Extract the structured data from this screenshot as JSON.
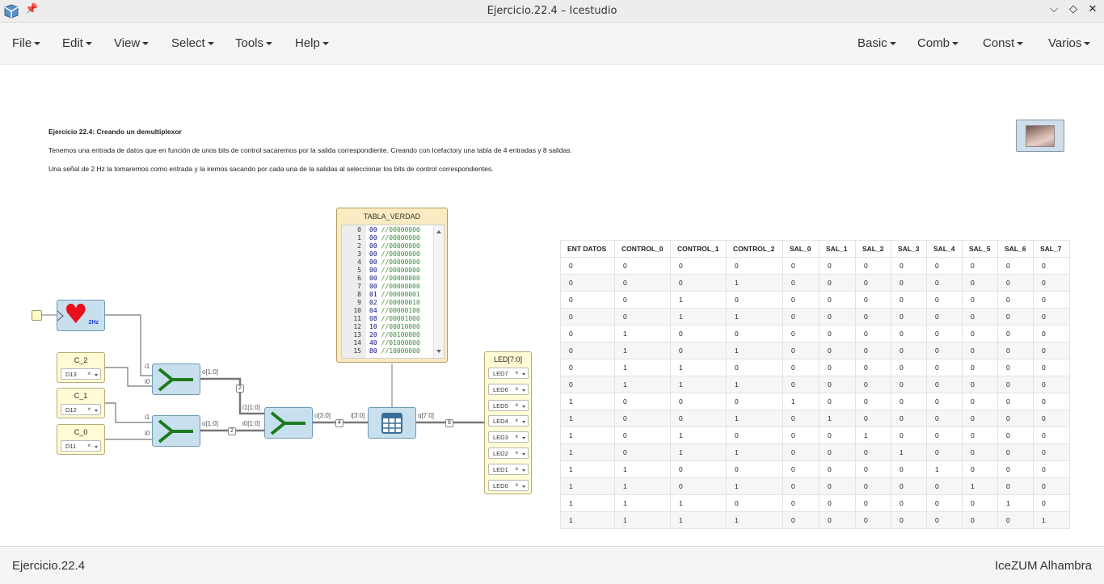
{
  "window": {
    "title": "Ejercicio.22.4 – Icestudio"
  },
  "menubar": {
    "left": [
      {
        "label": "File"
      },
      {
        "label": "Edit"
      },
      {
        "label": "View"
      },
      {
        "label": "Select"
      },
      {
        "label": "Tools"
      },
      {
        "label": "Help"
      }
    ],
    "right": [
      {
        "label": "Basic"
      },
      {
        "label": "Comb"
      },
      {
        "label": "Const"
      },
      {
        "label": "Varios"
      }
    ]
  },
  "info": {
    "title": "Ejercicio 22.4: Creando un demultiplexor",
    "line1": "Tenemos una entrada de datos que en función de unos bits de control sacaremos por la salida correspondiente. Creando con Icefactory una tabla de 4 entradas y 8 salidas.",
    "line2": "Una señal de 2 Hz la tomaremos como entrada y la iremos sacando por cada una de la salidas al seleccionar los bits de control correspondientes."
  },
  "clock": {
    "label": "2Hz"
  },
  "inputs": [
    {
      "name": "C_2",
      "pin": "D13"
    },
    {
      "name": "C_1",
      "pin": "D12"
    },
    {
      "name": "C_0",
      "pin": "D11"
    }
  ],
  "joiner_top": {
    "in1": "i1",
    "in0": "i0",
    "out": "o[1:0]"
  },
  "joiner_bottom": {
    "in1": "i1",
    "in0": "i0",
    "out": "o[1:0]"
  },
  "joiner_main": {
    "in1": "i1[1:0]",
    "in0": "i0[1:0]",
    "out": "o[3:0]"
  },
  "buses": {
    "b1": "2",
    "b2": "2",
    "b3": "4",
    "b4": "8"
  },
  "table_block": {
    "in": "i[3:0]",
    "out": "q[7:0]"
  },
  "truth_table": {
    "title": "TABLA_VERDAD",
    "lines": [
      {
        "n": "0",
        "hex": "00",
        "bin": "//00000000"
      },
      {
        "n": "1",
        "hex": "00",
        "bin": "//00000000"
      },
      {
        "n": "2",
        "hex": "00",
        "bin": "//00000000"
      },
      {
        "n": "3",
        "hex": "00",
        "bin": "//00000000"
      },
      {
        "n": "4",
        "hex": "00",
        "bin": "//00000000"
      },
      {
        "n": "5",
        "hex": "00",
        "bin": "//00000000"
      },
      {
        "n": "6",
        "hex": "00",
        "bin": "//00000000"
      },
      {
        "n": "7",
        "hex": "00",
        "bin": "//00000000"
      },
      {
        "n": "8",
        "hex": "01",
        "bin": "//00000001"
      },
      {
        "n": "9",
        "hex": "02",
        "bin": "//00000010"
      },
      {
        "n": "10",
        "hex": "04",
        "bin": "//00000100"
      },
      {
        "n": "11",
        "hex": "08",
        "bin": "//00001000"
      },
      {
        "n": "12",
        "hex": "10",
        "bin": "//00010000"
      },
      {
        "n": "13",
        "hex": "20",
        "bin": "//00100000"
      },
      {
        "n": "14",
        "hex": "40",
        "bin": "//01000000"
      },
      {
        "n": "15",
        "hex": "80",
        "bin": "//10000000"
      }
    ]
  },
  "output": {
    "name": "LED[7:0]",
    "pins": [
      "LED7",
      "LED6",
      "LED5",
      "LED4",
      "LED3",
      "LED2",
      "LED1",
      "LED0"
    ]
  },
  "table": {
    "headers": [
      "ENT DATOS",
      "CONTROL_0",
      "CONTROL_1",
      "CONTROL_2",
      "SAL_0",
      "SAL_1",
      "SAL_2",
      "SAL_3",
      "SAL_4",
      "SAL_5",
      "SAL_6",
      "SAL_7"
    ],
    "rows": [
      [
        "0",
        "0",
        "0",
        "0",
        "0",
        "0",
        "0",
        "0",
        "0",
        "0",
        "0",
        "0"
      ],
      [
        "0",
        "0",
        "0",
        "1",
        "0",
        "0",
        "0",
        "0",
        "0",
        "0",
        "0",
        "0"
      ],
      [
        "0",
        "0",
        "1",
        "0",
        "0",
        "0",
        "0",
        "0",
        "0",
        "0",
        "0",
        "0"
      ],
      [
        "0",
        "0",
        "1",
        "1",
        "0",
        "0",
        "0",
        "0",
        "0",
        "0",
        "0",
        "0"
      ],
      [
        "0",
        "1",
        "0",
        "0",
        "0",
        "0",
        "0",
        "0",
        "0",
        "0",
        "0",
        "0"
      ],
      [
        "0",
        "1",
        "0",
        "1",
        "0",
        "0",
        "0",
        "0",
        "0",
        "0",
        "0",
        "0"
      ],
      [
        "0",
        "1",
        "1",
        "0",
        "0",
        "0",
        "0",
        "0",
        "0",
        "0",
        "0",
        "0"
      ],
      [
        "0",
        "1",
        "1",
        "1",
        "0",
        "0",
        "0",
        "0",
        "0",
        "0",
        "0",
        "0"
      ],
      [
        "1",
        "0",
        "0",
        "0",
        "1",
        "0",
        "0",
        "0",
        "0",
        "0",
        "0",
        "0"
      ],
      [
        "1",
        "0",
        "0",
        "1",
        "0",
        "1",
        "0",
        "0",
        "0",
        "0",
        "0",
        "0"
      ],
      [
        "1",
        "0",
        "1",
        "0",
        "0",
        "0",
        "1",
        "0",
        "0",
        "0",
        "0",
        "0"
      ],
      [
        "1",
        "0",
        "1",
        "1",
        "0",
        "0",
        "0",
        "1",
        "0",
        "0",
        "0",
        "0"
      ],
      [
        "1",
        "1",
        "0",
        "0",
        "0",
        "0",
        "0",
        "0",
        "1",
        "0",
        "0",
        "0"
      ],
      [
        "1",
        "1",
        "0",
        "1",
        "0",
        "0",
        "0",
        "0",
        "0",
        "1",
        "0",
        "0"
      ],
      [
        "1",
        "1",
        "1",
        "0",
        "0",
        "0",
        "0",
        "0",
        "0",
        "0",
        "1",
        "0"
      ],
      [
        "1",
        "1",
        "1",
        "1",
        "0",
        "0",
        "0",
        "0",
        "0",
        "0",
        "0",
        "1"
      ]
    ]
  },
  "status": {
    "left": "Ejercicio.22.4",
    "right": "IceZUM Alhambra"
  }
}
